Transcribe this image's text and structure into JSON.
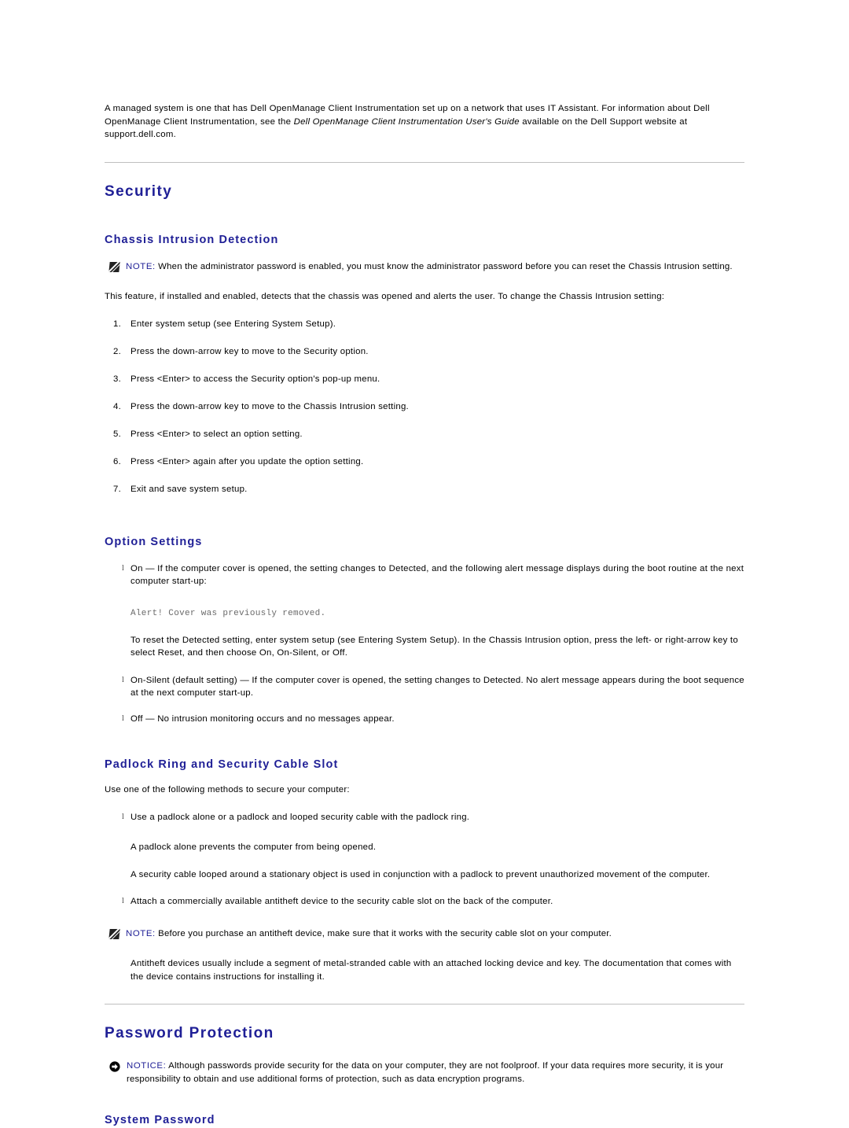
{
  "document": {
    "intro_paragraph": {
      "part1": "A managed system is one that has Dell OpenManage Client Instrumentation set up on a network that uses IT Assistant. For information about Dell OpenManage Client Instrumentation, see the ",
      "italic_title": "Dell OpenManage Client Instrumentation User's Guide",
      "part2": " available on the Dell Support website at support.dell.com."
    },
    "heading_colors": {
      "heading_blue": "#1f1f96",
      "divider_gray": "#bfbfbf",
      "mono_gray": "#6a6a6a"
    },
    "sections": {
      "security": {
        "title": "Security",
        "chassis_intrusion": {
          "title": "Chassis Intrusion Detection",
          "note": {
            "icon": "note-pencil-icon",
            "label": "NOTE:",
            "text": " When the administrator password is enabled, you must know the administrator password before you can reset the Chassis Intrusion setting."
          },
          "intro": "This feature, if installed and enabled, detects that the chassis was opened and alerts the user. To change the Chassis Intrusion setting:",
          "steps": [
            {
              "number": "1.",
              "text": "Enter system setup (see Entering System Setup)."
            },
            {
              "number": "2.",
              "text": "Press the down-arrow key to move to the Security option."
            },
            {
              "number": "3.",
              "text": "Press <Enter> to access the Security option's pop-up menu."
            },
            {
              "number": "4.",
              "text": "Press the down-arrow key to move to the Chassis Intrusion setting."
            },
            {
              "number": "5.",
              "text": "Press <Enter> to select an option setting."
            },
            {
              "number": "6.",
              "text": "Press <Enter> again after you update the option setting."
            },
            {
              "number": "7.",
              "text": "Exit and save system setup."
            }
          ]
        },
        "option_settings": {
          "title": "Option Settings",
          "bullet_glyph": "l",
          "bullet_on": "On — If the computer cover is opened, the setting changes to Detected, and the following alert message displays during the boot routine at the next computer start-up:",
          "alert_message": "Alert! Cover was previously removed.",
          "reset_paragraph": "To reset the Detected setting, enter system setup (see Entering System Setup). In the Chassis Intrusion option, press the left- or right-arrow key to select Reset, and then choose On, On-Silent, or Off.",
          "bullet_on_silent": "On-Silent (default setting) — If the computer cover is opened, the setting changes to Detected. No alert message appears during the boot sequence at the next computer start-up.",
          "bullet_off": "Off — No intrusion monitoring occurs and no messages appear."
        },
        "padlock_ring": {
          "title": "Padlock Ring and Security Cable Slot",
          "intro": "Use one of the following methods to secure your computer:",
          "bullet_padlock": "Use a padlock alone or a padlock and looped security cable with the padlock ring.",
          "sub_padlock_alone": "A padlock alone prevents the computer from being opened.",
          "sub_security_cable": "A security cable looped around a stationary object is used in conjunction with a padlock to prevent unauthorized movement of the computer.",
          "bullet_antitheft": "Attach a commercially available antitheft device to the security cable slot on the back of the computer.",
          "note": {
            "icon": "note-pencil-icon",
            "label": "NOTE:",
            "text": " Before you purchase an antitheft device, make sure that it works with the security cable slot on your computer."
          },
          "closing_paragraph": "Antitheft devices usually include a segment of metal-stranded cable with an attached locking device and key. The documentation that comes with the device contains instructions for installing it."
        }
      },
      "password_protection": {
        "title": "Password Protection",
        "notice": {
          "icon": "notice-arrow-icon",
          "label": "NOTICE:",
          "text": " Although passwords provide security for the data on your computer, they are not foolproof. If your data requires more security, it is your responsibility to obtain and use additional forms of protection, such as data encryption programs."
        },
        "system_password": {
          "title": "System Password"
        }
      }
    }
  }
}
